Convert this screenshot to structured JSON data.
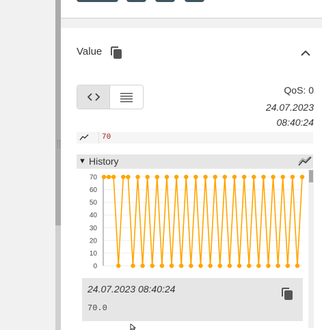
{
  "value_section": {
    "title": "Value",
    "qos": "QoS: 0",
    "timestamp_date": "24.07.2023",
    "timestamp_time": "08:40:24",
    "current_value": "70"
  },
  "history": {
    "title": "History",
    "selected_timestamp": "24.07.2023 08:40:24",
    "selected_value": "70.0"
  },
  "colors": {
    "series": "#FFA500",
    "toolbar_button": "#3f5560"
  },
  "icons": {
    "copy": "copy-icon",
    "collapse": "chevron-up-icon",
    "code_view": "code-icon",
    "list_view": "list-icon",
    "sparkline": "sparkline-icon",
    "chart": "line-chart-icon",
    "expand_arrow": "triangle-down-icon"
  },
  "chart_data": {
    "type": "line",
    "yticks": [
      0,
      10,
      20,
      30,
      40,
      50,
      60,
      70
    ],
    "ylim": [
      0,
      70
    ],
    "grid": true,
    "series": [
      {
        "values": [
          70,
          70,
          70,
          0,
          70,
          70,
          0,
          70,
          0,
          70,
          0,
          70,
          0,
          70,
          0,
          70,
          0,
          70,
          0,
          70,
          0,
          70,
          0,
          70,
          0,
          70,
          0,
          70,
          0,
          70,
          0,
          70,
          0,
          70,
          0,
          70,
          0,
          70,
          0,
          70,
          0,
          70
        ]
      }
    ]
  }
}
